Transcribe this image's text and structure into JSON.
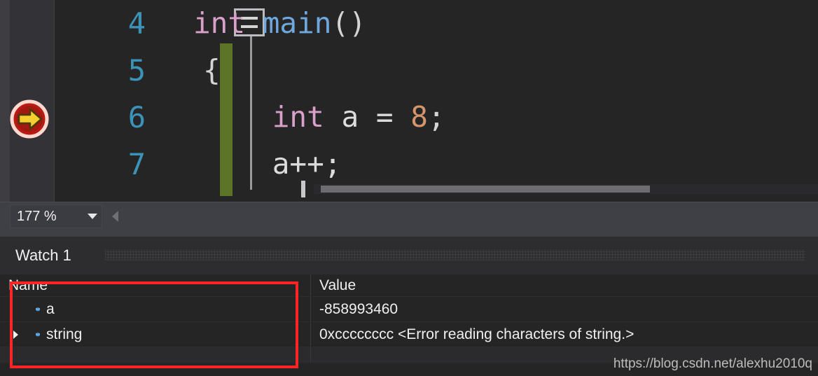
{
  "editor": {
    "execution_pointer_icon": "yellow-arrow-in-red-circle",
    "collapse_toggle_icon": "collapse-minus-box",
    "change_bar_color": "#5b7428",
    "line_number_color": "#3b93b7",
    "lines": [
      {
        "number": "4",
        "segments": [
          {
            "text": "int",
            "kind": "keyword"
          },
          {
            "text": " ",
            "kind": "plain"
          },
          {
            "text": "main",
            "kind": "function"
          },
          {
            "text": "()",
            "kind": "punct"
          }
        ]
      },
      {
        "number": "5",
        "segments": [
          {
            "text": "{",
            "kind": "punct"
          }
        ]
      },
      {
        "number": "6",
        "segments": [
          {
            "text": "    int",
            "kind": "keyword"
          },
          {
            "text": " a = ",
            "kind": "plain"
          },
          {
            "text": "8",
            "kind": "number"
          },
          {
            "text": ";",
            "kind": "punct"
          }
        ]
      },
      {
        "number": "7",
        "segments": [
          {
            "text": "    a++;",
            "kind": "plain"
          }
        ]
      }
    ]
  },
  "nav_bar": {
    "zoom_level": "177 %",
    "zoom_caret_icon": "chevron-down-icon",
    "splitter_icon": "triangle-left-icon"
  },
  "watch_panel": {
    "tab_label": "Watch 1",
    "columns": {
      "name": "Name",
      "value": "Value"
    },
    "rows": [
      {
        "expandable": false,
        "expander_icon": "",
        "icon": "field-icon",
        "name": "a",
        "value": "-858993460"
      },
      {
        "expandable": true,
        "expander_icon": "triangle-right-icon",
        "icon": "field-icon",
        "name": "string",
        "value": "0xcccccccc <Error reading characters of string.>"
      }
    ],
    "highlight_color": "#fb2525"
  },
  "watermark": {
    "text": "https://blog.csdn.net/alexhu2010q"
  }
}
